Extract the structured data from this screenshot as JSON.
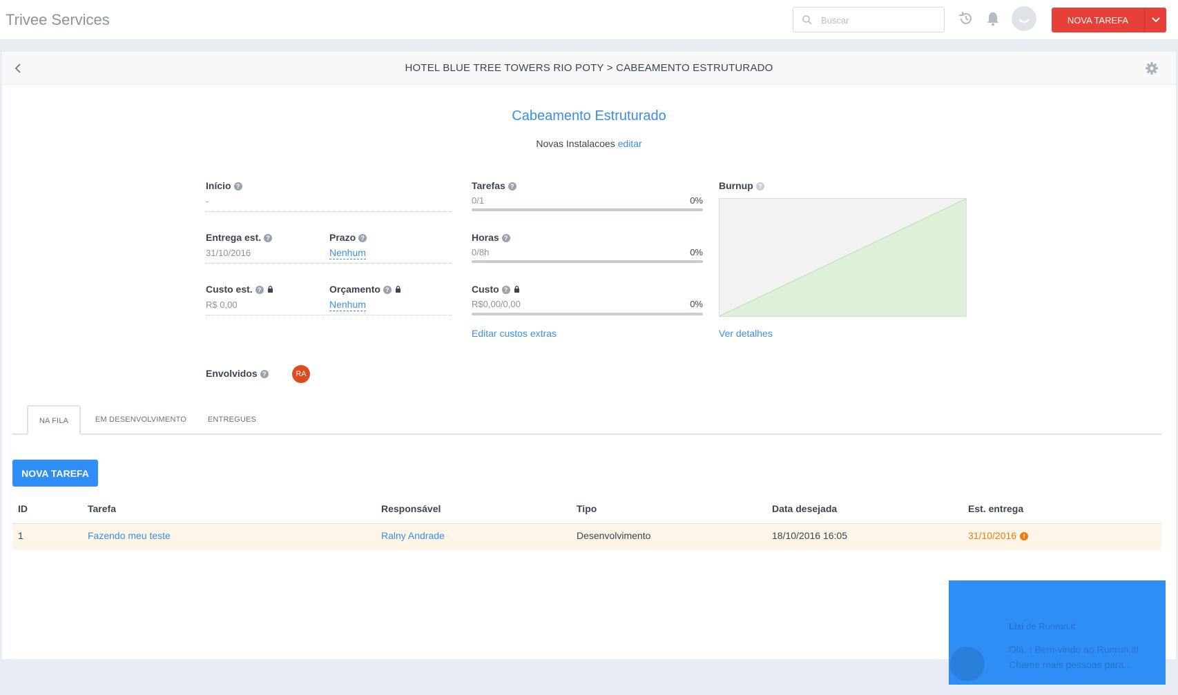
{
  "app": {
    "brand": "Trivee Services"
  },
  "header": {
    "search_placeholder": "Buscar",
    "new_task_label": "NOVA TAREFA"
  },
  "page": {
    "breadcrumb": "HOTEL BLUE TREE TOWERS RIO POTY > CABEAMENTO ESTRUTURADO",
    "title": "Cabeamento Estruturado",
    "subtitle": "Novas Instalacoes",
    "edit_link": "editar"
  },
  "fields": {
    "inicio_label": "Início",
    "inicio_value": "-",
    "entrega_label": "Entrega est.",
    "entrega_value": "31/10/2016",
    "prazo_label": "Prazo",
    "prazo_value": "Nenhum",
    "custo_label": "Custo est.",
    "custo_value": "R$ 0,00",
    "orcamento_label": "Orçamento",
    "orcamento_value": "Nenhum",
    "envolvidos_label": "Envolvidos",
    "envolvido_initials": "RA"
  },
  "progress": {
    "tarefas": {
      "label": "Tarefas",
      "value": "0/1",
      "pct": "0%"
    },
    "horas": {
      "label": "Horas",
      "value": "0/8h",
      "pct": "0%"
    },
    "custo": {
      "label": "Custo",
      "value": "R$0,00/0,00",
      "pct": "0%"
    },
    "extras_link": "Editar custos extras"
  },
  "burnup": {
    "label": "Burnup",
    "details_link": "Ver detalhes"
  },
  "tabs": [
    {
      "label": "NA FILA",
      "active": true
    },
    {
      "label": "EM DESENVOLVIMENTO",
      "active": false
    },
    {
      "label": "ENTREGUES",
      "active": false
    }
  ],
  "new_task_button": "NOVA TAREFA",
  "table": {
    "columns": [
      "ID",
      "Tarefa",
      "Responsável",
      "Tipo",
      "Data desejada",
      "Est. entrega"
    ],
    "rows": [
      {
        "id": "1",
        "tarefa": "Fazendo meu teste",
        "responsavel": "Ralny Andrade",
        "tipo": "Desenvolvimento",
        "data_desejada": "18/10/2016 16:05",
        "est_entrega": "31/10/2016"
      }
    ]
  },
  "chat": {
    "sender": "Lizi",
    "from": "de Runrun.it",
    "message": "Olá, ! Bem-vindo ao Runrun.it! Chame mais pessoas para..."
  },
  "colors": {
    "accent": "#3b8ee8",
    "primary_button": "#2f8ef5",
    "danger_button": "#e74038",
    "row_highlight": "#fcf5e8",
    "late_date": "#f07a0f"
  }
}
